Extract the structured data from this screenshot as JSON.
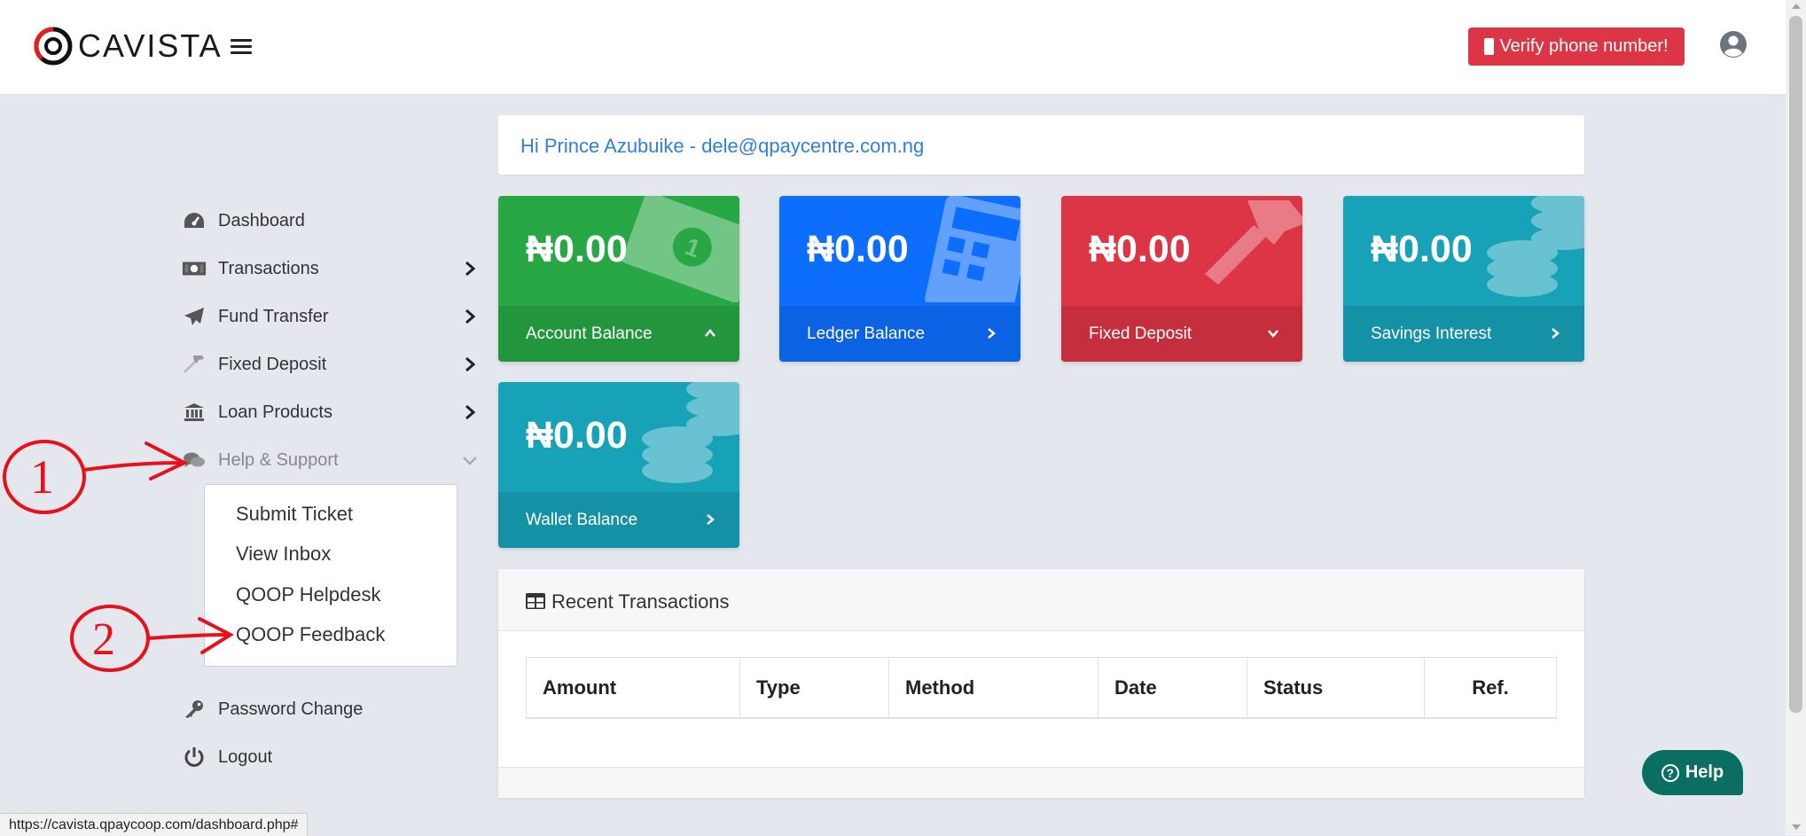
{
  "header": {
    "logo_text": "CAVISTA",
    "verify_label": "Verify phone number!"
  },
  "sidebar": {
    "items": [
      {
        "label": "Dashboard",
        "icon": "dashboard-icon"
      },
      {
        "label": "Transactions",
        "icon": "money-icon"
      },
      {
        "label": "Fund Transfer",
        "icon": "paper-plane-icon"
      },
      {
        "label": "Fixed Deposit",
        "icon": "hammer-icon"
      },
      {
        "label": "Loan Products",
        "icon": "bank-icon"
      },
      {
        "label": "Help & Support",
        "icon": "comments-icon"
      },
      {
        "label": "Password Change",
        "icon": "key-icon"
      },
      {
        "label": "Logout",
        "icon": "power-icon"
      }
    ],
    "submenu": [
      "Submit Ticket",
      "View Inbox",
      "QOOP Helpdesk",
      "QOOP Feedback"
    ]
  },
  "greeting": "Hi Prince Azubuike - dele@qpaycentre.com.ng",
  "cards": [
    {
      "amount": "₦0.00",
      "label": "Account Balance",
      "color": "#28a745"
    },
    {
      "amount": "₦0.00",
      "label": "Ledger Balance",
      "color": "#0d6efd"
    },
    {
      "amount": "₦0.00",
      "label": "Fixed Deposit",
      "color": "#dc3545"
    },
    {
      "amount": "₦0.00",
      "label": "Savings Interest",
      "color": "#17a2b8"
    },
    {
      "amount": "₦0.00",
      "label": "Wallet Balance",
      "color": "#17a2b8"
    }
  ],
  "transactions": {
    "title": "Recent Transactions",
    "columns": [
      "Amount",
      "Type",
      "Method",
      "Date",
      "Status",
      "Ref."
    ]
  },
  "help_label": "Help",
  "status_url": "https://cavista.qpaycoop.com/dashboard.php#",
  "annotations": [
    "1",
    "2"
  ]
}
